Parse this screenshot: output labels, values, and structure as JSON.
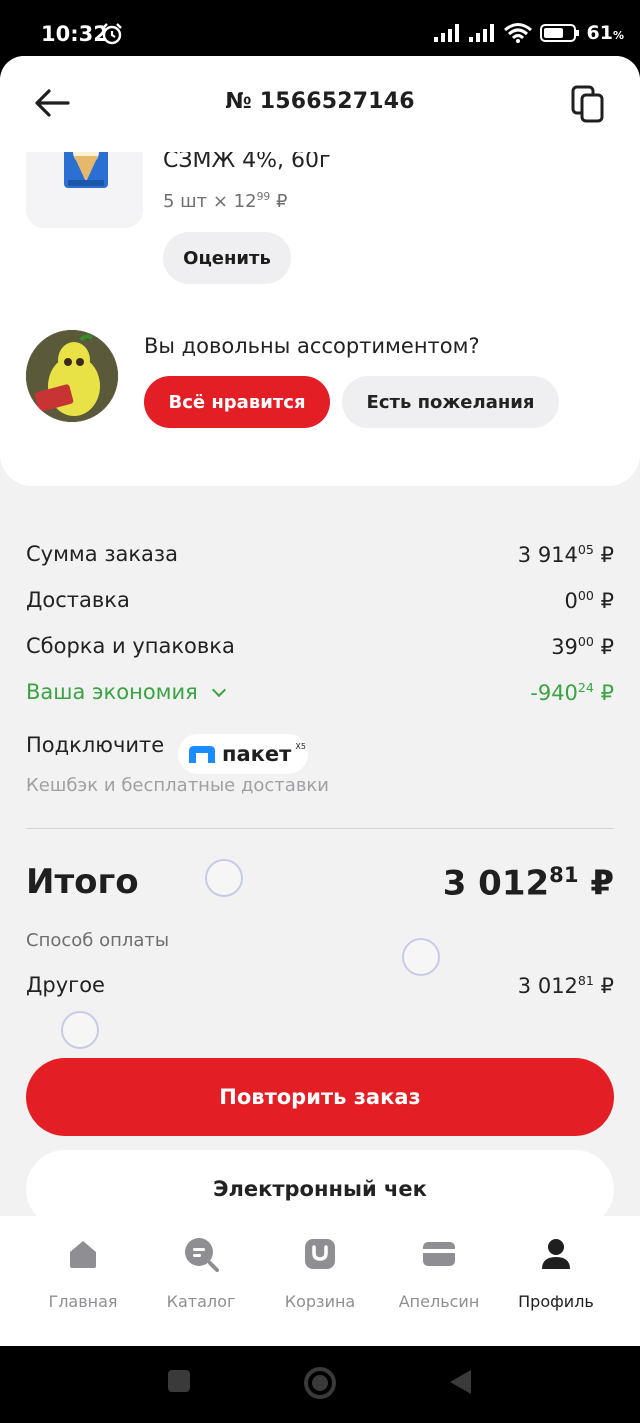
{
  "status_bar": {
    "time": "10:32",
    "battery_value": "61",
    "battery_unit": "%"
  },
  "header": {
    "order_number": "№ 1566527146"
  },
  "product": {
    "name": "СЗМЖ 4%, 60г",
    "qty_prefix": "5 шт × 12",
    "qty_cents": "99",
    "qty_currency": " ₽",
    "rate_label": "Оценить"
  },
  "survey": {
    "question": "Вы довольны ассортиментом?",
    "like_label": "Всё нравится",
    "wish_label": "Есть пожелания"
  },
  "summary": {
    "rows": [
      {
        "label": "Сумма заказа",
        "int": "3 914",
        "cents": "05",
        "cur": " ₽"
      },
      {
        "label": "Доставка",
        "int": "0",
        "cents": "00",
        "cur": " ₽"
      },
      {
        "label": "Сборка и упаковка",
        "int": "39",
        "cents": "00",
        "cur": " ₽"
      },
      {
        "label": "Ваша экономия",
        "int": "-940",
        "cents": "24",
        "cur": " ₽"
      }
    ],
    "accent_green": "#3aa342"
  },
  "promo": {
    "connect_label": "Подключите",
    "brand": "пакет",
    "brand_sub": "Х5",
    "subtitle": "Кешбэк и бесплатные доставки"
  },
  "total": {
    "label": "Итого",
    "int": "3 012",
    "cents": "81",
    "cur": " ₽",
    "payment_label": "Способ оплаты",
    "payment_method": "Другое",
    "payment_int": "3 012",
    "payment_cents": "81",
    "payment_cur": " ₽"
  },
  "actions": {
    "repeat_label": "Повторить заказ",
    "receipt_label": "Электронный чек"
  },
  "bottom_nav": {
    "items": [
      {
        "label": "Главная",
        "icon": "home-icon"
      },
      {
        "label": "Каталог",
        "icon": "catalog-search-icon"
      },
      {
        "label": "Корзина",
        "icon": "cart-bag-icon"
      },
      {
        "label": "Апельсин",
        "icon": "card-icon"
      },
      {
        "label": "Профиль",
        "icon": "profile-icon"
      }
    ],
    "active": "Профиль"
  },
  "colors": {
    "brand_red": "#e31e24",
    "background": "#f2f2f3"
  }
}
